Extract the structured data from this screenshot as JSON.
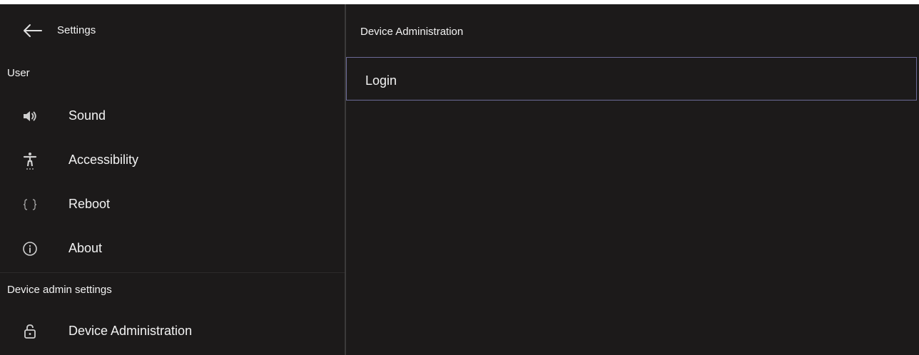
{
  "sidebar": {
    "title": "Settings",
    "sections": [
      {
        "label": "User",
        "items": [
          {
            "label": "Sound",
            "icon": "speaker-icon"
          },
          {
            "label": "Accessibility",
            "icon": "accessibility-icon"
          },
          {
            "label": "Reboot",
            "icon": "braces-icon"
          },
          {
            "label": "About",
            "icon": "info-icon"
          }
        ]
      },
      {
        "label": "Device admin settings",
        "items": [
          {
            "label": "Device Administration",
            "icon": "lock-icon"
          }
        ]
      }
    ]
  },
  "main": {
    "title": "Device Administration",
    "items": [
      {
        "label": "Login"
      }
    ]
  },
  "colors": {
    "background": "#1c1a1a",
    "text": "#f2f2f2",
    "selection_border": "#6b6a97",
    "divider": "#3b3a3a"
  }
}
